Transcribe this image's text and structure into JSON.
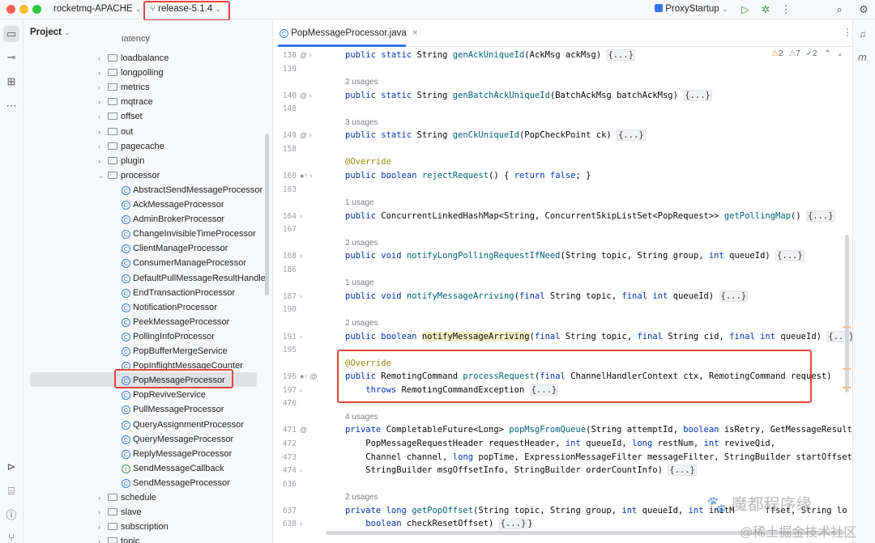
{
  "titlebar": {
    "project_name": "rocketmq-APACHE",
    "branch": "release-5.1.4",
    "run_config": "ProxyStartup"
  },
  "project_panel": {
    "header": "Project",
    "partial_top_item": "latency",
    "items": [
      {
        "label": "loadbalance",
        "type": "folder"
      },
      {
        "label": "longpolling",
        "type": "folder"
      },
      {
        "label": "metrics",
        "type": "folder"
      },
      {
        "label": "mqtrace",
        "type": "folder"
      },
      {
        "label": "offset",
        "type": "folder"
      },
      {
        "label": "out",
        "type": "folder"
      },
      {
        "label": "pagecache",
        "type": "folder"
      },
      {
        "label": "plugin",
        "type": "folder"
      },
      {
        "label": "processor",
        "type": "folder-open"
      },
      {
        "label": "AbstractSendMessageProcessor",
        "type": "class"
      },
      {
        "label": "AckMessageProcessor",
        "type": "class"
      },
      {
        "label": "AdminBrokerProcessor",
        "type": "class"
      },
      {
        "label": "ChangeInvisibleTimeProcessor",
        "type": "class"
      },
      {
        "label": "ClientManageProcessor",
        "type": "class"
      },
      {
        "label": "ConsumerManageProcessor",
        "type": "class"
      },
      {
        "label": "DefaultPullMessageResultHandler",
        "type": "class"
      },
      {
        "label": "EndTransactionProcessor",
        "type": "class"
      },
      {
        "label": "NotificationProcessor",
        "type": "class"
      },
      {
        "label": "PeekMessageProcessor",
        "type": "class"
      },
      {
        "label": "PollingInfoProcessor",
        "type": "class"
      },
      {
        "label": "PopBufferMergeService",
        "type": "class"
      },
      {
        "label": "PopInflightMessageCounter",
        "type": "class"
      },
      {
        "label": "PopMessageProcessor",
        "type": "class",
        "selected": true
      },
      {
        "label": "PopReviveService",
        "type": "class"
      },
      {
        "label": "PullMessageProcessor",
        "type": "class"
      },
      {
        "label": "QueryAssignmentProcessor",
        "type": "class"
      },
      {
        "label": "QueryMessageProcessor",
        "type": "class"
      },
      {
        "label": "ReplyMessageProcessor",
        "type": "class"
      },
      {
        "label": "SendMessageCallback",
        "type": "interface"
      },
      {
        "label": "SendMessageProcessor",
        "type": "class"
      },
      {
        "label": "schedule",
        "type": "folder"
      },
      {
        "label": "slave",
        "type": "folder"
      },
      {
        "label": "subscription",
        "type": "folder"
      },
      {
        "label": "topic",
        "type": "folder"
      }
    ]
  },
  "editor": {
    "tab_label": "PopMessageProcessor.java",
    "inspection": {
      "warnings": "2",
      "weak": "7",
      "ok": "2"
    },
    "lines": [
      {
        "n": "138",
        "g": "@ ›",
        "s": [
          [
            "kw",
            "public static "
          ],
          [
            "",
            "String "
          ],
          [
            "fn",
            "genAckUniqueId"
          ],
          [
            "",
            "(AckMsg ackMsg) "
          ],
          [
            "fold",
            "{...}"
          ]
        ]
      },
      {
        "n": "139",
        "s": []
      },
      {
        "usage": "2 usages"
      },
      {
        "n": "140",
        "g": "@ ›",
        "s": [
          [
            "kw",
            "public static "
          ],
          [
            "",
            "String "
          ],
          [
            "fn",
            "genBatchAckUniqueId"
          ],
          [
            "",
            "(BatchAckMsg batchAckMsg) "
          ],
          [
            "fold",
            "{...}"
          ]
        ]
      },
      {
        "n": "148",
        "s": []
      },
      {
        "usage": "3 usages"
      },
      {
        "n": "149",
        "g": "@ ›",
        "s": [
          [
            "kw",
            "public static "
          ],
          [
            "",
            "String "
          ],
          [
            "fn",
            "genCkUniqueId"
          ],
          [
            "",
            "(PopCheckPoint ck) "
          ],
          [
            "fold",
            "{...}"
          ]
        ]
      },
      {
        "n": "158",
        "s": []
      },
      {
        "n": "",
        "s": [
          [
            "an",
            "@Override"
          ]
        ]
      },
      {
        "n": "160",
        "g": "●↑ ›",
        "s": [
          [
            "kw",
            "public boolean "
          ],
          [
            "fn",
            "rejectRequest"
          ],
          [
            "",
            "() { "
          ],
          [
            "kw",
            "return false"
          ],
          [
            "",
            "; }"
          ]
        ]
      },
      {
        "n": "163",
        "s": []
      },
      {
        "usage": "1 usage"
      },
      {
        "n": "164",
        "g": "  ›",
        "s": [
          [
            "kw",
            "public "
          ],
          [
            "",
            "ConcurrentLinkedHashMap<String, ConcurrentSkipListSet<PopRequest>> "
          ],
          [
            "fn",
            "getPollingMap"
          ],
          [
            "",
            "() "
          ],
          [
            "fold",
            "{...}"
          ]
        ]
      },
      {
        "n": "167",
        "s": []
      },
      {
        "usage": "2 usages"
      },
      {
        "n": "168",
        "g": "  ›",
        "s": [
          [
            "kw",
            "public void "
          ],
          [
            "fn",
            "notifyLongPollingRequestIfNeed"
          ],
          [
            "",
            "(String topic, String group, "
          ],
          [
            "kw",
            "int "
          ],
          [
            "",
            "queueId) "
          ],
          [
            "fold",
            "{...}"
          ]
        ]
      },
      {
        "n": "186",
        "s": []
      },
      {
        "usage": "1 usage"
      },
      {
        "n": "187",
        "g": "  ›",
        "s": [
          [
            "kw",
            "public void "
          ],
          [
            "fn",
            "notifyMessageArriving"
          ],
          [
            "",
            "("
          ],
          [
            "kw",
            "final "
          ],
          [
            "",
            "String topic, "
          ],
          [
            "kw",
            "final int "
          ],
          [
            "",
            "queueId) "
          ],
          [
            "fold",
            "{...}"
          ]
        ]
      },
      {
        "n": "190",
        "s": []
      },
      {
        "usage": "2 usages"
      },
      {
        "n": "191",
        "g": "  ›",
        "s": [
          [
            "kw",
            "public boolean "
          ],
          [
            "hl",
            "notifyMessageArriving"
          ],
          [
            "",
            "("
          ],
          [
            "kw",
            "final "
          ],
          [
            "",
            "String topic, "
          ],
          [
            "kw",
            "final "
          ],
          [
            "",
            "String cid, "
          ],
          [
            "kw",
            "final int "
          ],
          [
            "",
            "queueId) "
          ],
          [
            "fold",
            "{...}"
          ]
        ]
      },
      {
        "n": "195",
        "s": []
      },
      {
        "n": "",
        "s": [
          [
            "an",
            "@Override"
          ]
        ]
      },
      {
        "n": "196",
        "g": "●↑ @",
        "s": [
          [
            "kw",
            "public "
          ],
          [
            "",
            "RemotingCommand "
          ],
          [
            "fn",
            "processRequest"
          ],
          [
            "",
            "("
          ],
          [
            "kw",
            "final "
          ],
          [
            "",
            "ChannelHandlerContext ctx, RemotingCommand request)"
          ]
        ]
      },
      {
        "n": "197",
        "g": "  ›",
        "s": [
          [
            "",
            "    "
          ],
          [
            "kw",
            "throws "
          ],
          [
            "",
            "RemotingCommandException "
          ],
          [
            "fold",
            "{...}"
          ]
        ]
      },
      {
        "n": "470",
        "s": []
      },
      {
        "usage": "4 usages"
      },
      {
        "n": "471",
        "g": "  @",
        "s": [
          [
            "kw",
            "private "
          ],
          [
            "",
            "CompletableFuture<Long> "
          ],
          [
            "fn",
            "popMsgFromQueue"
          ],
          [
            "",
            "(String attemptId, "
          ],
          [
            "kw",
            "boolean "
          ],
          [
            "",
            "isRetry, GetMessageResult getM"
          ]
        ]
      },
      {
        "n": "472",
        "s": [
          [
            "",
            "    PopMessageRequestHeader requestHeader, "
          ],
          [
            "kw",
            "int "
          ],
          [
            "",
            "queueId, "
          ],
          [
            "kw",
            "long "
          ],
          [
            "",
            "restNum, "
          ],
          [
            "kw",
            "int "
          ],
          [
            "",
            "reviveQid,"
          ]
        ]
      },
      {
        "n": "473",
        "s": [
          [
            "",
            "    Channel channel, "
          ],
          [
            "kw",
            "long "
          ],
          [
            "",
            "popTime, ExpressionMessageFilter messageFilter, StringBuilder startOffsetInfo,"
          ]
        ]
      },
      {
        "n": "474",
        "g": "  ›",
        "s": [
          [
            "",
            "    StringBuilder msgOffsetInfo, StringBuilder orderCountInfo) "
          ],
          [
            "fold",
            "{...}"
          ]
        ]
      },
      {
        "n": "636",
        "s": []
      },
      {
        "usage": "2 usages"
      },
      {
        "n": "637",
        "s": [
          [
            "kw",
            "private long "
          ],
          [
            "fn",
            "getPopOffset"
          ],
          [
            "",
            "(String topic, String group, "
          ],
          [
            "kw",
            "int "
          ],
          [
            "",
            "queueId, "
          ],
          [
            "kw",
            "int "
          ],
          [
            "",
            "initM"
          ],
          [
            "kw",
            "      "
          ],
          [
            "",
            "ffset, String lo"
          ]
        ]
      },
      {
        "n": "638",
        "g": "  ›",
        "s": [
          [
            "",
            "    "
          ],
          [
            "kw",
            "boolean "
          ],
          [
            "",
            "checkResetOffset) "
          ],
          [
            "fold",
            "{...}"
          ],
          [
            "",
            "}"
          ]
        ]
      }
    ]
  },
  "watermark": {
    "line1": "🐾 魔都程序缘",
    "line2": "@稀土掘金技术社区"
  },
  "colors": {
    "highlight_box": "#e1463e",
    "keyword": "#0033b3",
    "method": "#00627a",
    "annotation": "#9e880d",
    "selection": "#dfe1e5",
    "accent": "#3574f0"
  }
}
